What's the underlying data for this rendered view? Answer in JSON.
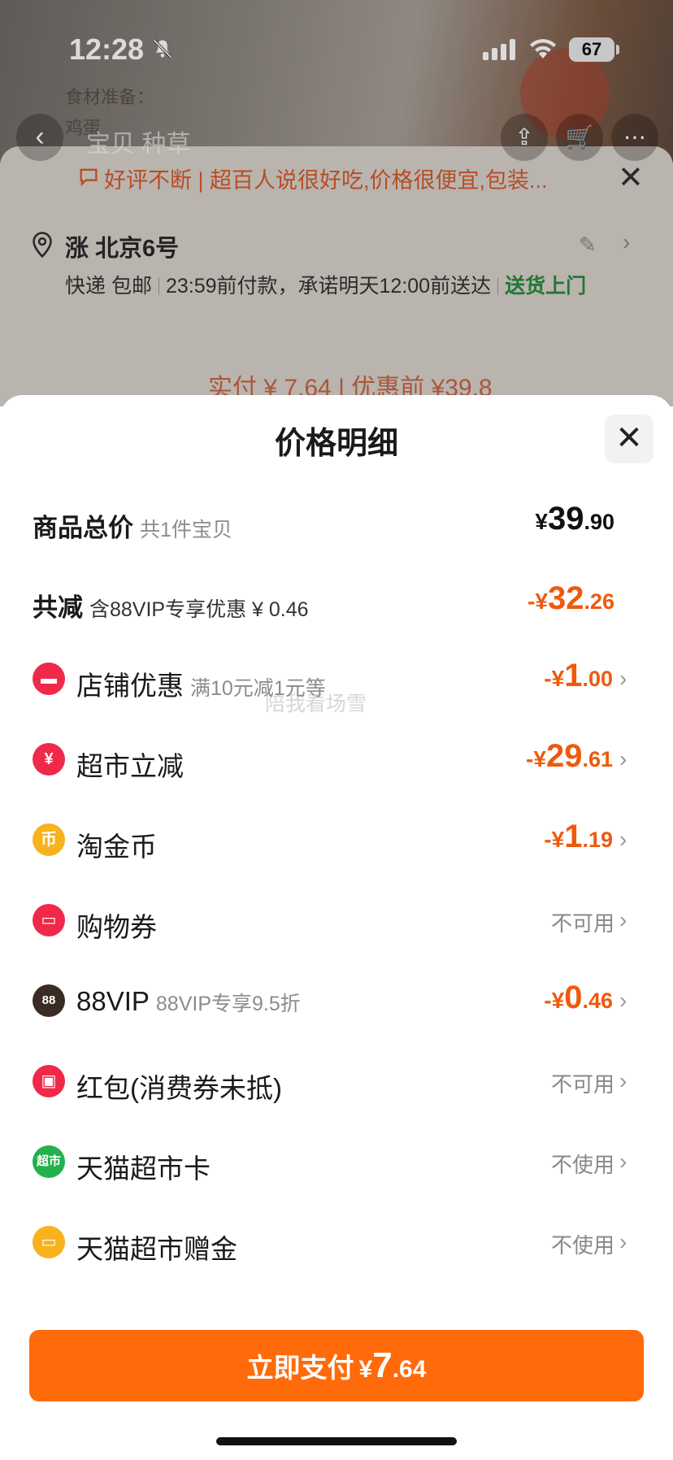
{
  "status_bar": {
    "time": "12:28",
    "battery": "67"
  },
  "background": {
    "photo_text": "食材准备：",
    "photo_text2": "鸡蛋",
    "tabs": "宝贝  种草",
    "notice": "好评不断 | 超百人说很好吃,价格很便宜,包装...",
    "address_name": "涨 北京6号",
    "delivery": "快递 包邮",
    "deadline": "23:59前付款，承诺明天12:00前送达",
    "door": "送货上门",
    "paid_summary": "实付 ¥ 7.64 | 优惠前 ¥39.8"
  },
  "sheet": {
    "title": "价格明细",
    "total": {
      "label": "商品总价",
      "sub": "共1件宝贝",
      "currency": "¥",
      "int": "39",
      "dec": ".90"
    },
    "reduce": {
      "label": "共减",
      "sub": "含88VIP专享优惠 ¥ 0.46",
      "prefix": "-¥",
      "int": "32",
      "dec": ".26"
    },
    "items": [
      {
        "label": "店铺优惠",
        "sub": "满10元减1元等",
        "prefix": "-¥",
        "int": "1",
        "dec": ".00",
        "icon": "store-coupon-icon",
        "color": "#f0294b"
      },
      {
        "label": "超市立减",
        "sub": "",
        "prefix": "-¥",
        "int": "29",
        "dec": ".61",
        "icon": "yen-discount-icon",
        "color": "#f0294b"
      },
      {
        "label": "淘金币",
        "sub": "",
        "prefix": "-¥",
        "int": "1",
        "dec": ".19",
        "icon": "gold-coin-icon",
        "color": "#f7b21c"
      },
      {
        "label": "购物券",
        "sub": "",
        "status": "不可用",
        "icon": "ticket-icon",
        "color": "#f0294b"
      },
      {
        "label": "88VIP",
        "sub": "88VIP专享9.5折",
        "prefix": "-¥",
        "int": "0",
        "dec": ".46",
        "icon": "vip-88-icon",
        "color": "#3a2c24"
      },
      {
        "label": "红包(消费券未抵)",
        "sub": "",
        "status": "不可用",
        "icon": "red-packet-icon",
        "color": "#f0294b"
      },
      {
        "label": "天猫超市卡",
        "sub": "",
        "status": "不使用",
        "icon": "tmall-supermarket-card-icon",
        "color": "#21b24b"
      },
      {
        "label": "天猫超市赠金",
        "sub": "",
        "status": "不使用",
        "icon": "gift-money-icon",
        "color": "#f7b21c"
      }
    ],
    "watermark": "陪我看场雪",
    "pay_button": {
      "label": "立即支付",
      "currency": "¥",
      "int": "7",
      "dec": ".64"
    }
  }
}
